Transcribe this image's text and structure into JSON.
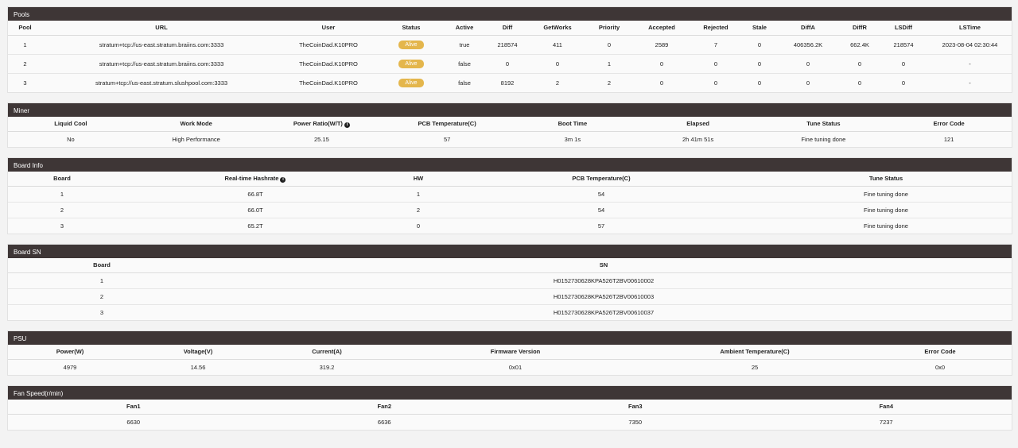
{
  "pools": {
    "title": "Pools",
    "columns": [
      "Pool",
      "URL",
      "User",
      "Status",
      "Active",
      "Diff",
      "GetWorks",
      "Priority",
      "Accepted",
      "Rejected",
      "Stale",
      "DiffA",
      "DiffR",
      "LSDiff",
      "LSTime"
    ],
    "rows": [
      [
        "1",
        "stratum+tcp://us-east.stratum.braiins.com:3333",
        "TheCoinDad.K10PRO",
        "Alive",
        "true",
        "218574",
        "411",
        "0",
        "2589",
        "7",
        "0",
        "406356.2K",
        "662.4K",
        "218574",
        "2023-08-04 02:30:44"
      ],
      [
        "2",
        "stratum+tcp://us-east.stratum.braiins.com:3333",
        "TheCoinDad.K10PRO",
        "Alive",
        "false",
        "0",
        "0",
        "1",
        "0",
        "0",
        "0",
        "0",
        "0",
        "0",
        "-"
      ],
      [
        "3",
        "stratum+tcp://us-east.stratum.slushpool.com:3333",
        "TheCoinDad.K10PRO",
        "Alive",
        "false",
        "8192",
        "2",
        "2",
        "0",
        "0",
        "0",
        "0",
        "0",
        "0",
        "-"
      ]
    ]
  },
  "miner": {
    "title": "Miner",
    "columns": [
      "Liquid Cool",
      "Work Mode",
      "Power Ratio(W/T)",
      "PCB Temperature(C)",
      "Boot Time",
      "Elapsed",
      "Tune Status",
      "Error Code"
    ],
    "rows": [
      [
        "No",
        "High Performance",
        "25.15",
        "57",
        "3m 1s",
        "2h 41m 51s",
        "Fine tuning done",
        "121"
      ]
    ]
  },
  "board_info": {
    "title": "Board Info",
    "columns": [
      "Board",
      "Real-time Hashrate",
      "HW",
      "PCB Temperature(C)",
      "Tune Status"
    ],
    "rows": [
      [
        "1",
        "66.8T",
        "1",
        "54",
        "Fine tuning done"
      ],
      [
        "2",
        "66.0T",
        "2",
        "54",
        "Fine tuning done"
      ],
      [
        "3",
        "65.2T",
        "0",
        "57",
        "Fine tuning done"
      ]
    ]
  },
  "board_sn": {
    "title": "Board SN",
    "columns": [
      "Board",
      "SN"
    ],
    "rows": [
      [
        "1",
        "H0152730628KPA526T2BV00610002"
      ],
      [
        "2",
        "H0152730628KPA526T2BV00610003"
      ],
      [
        "3",
        "H0152730628KPA526T2BV00610037"
      ]
    ]
  },
  "psu": {
    "title": "PSU",
    "columns": [
      "Power(W)",
      "Voltage(V)",
      "Current(A)",
      "Firmware Version",
      "Ambient Temperature(C)",
      "Error Code"
    ],
    "rows": [
      [
        "4979",
        "14.56",
        "319.2",
        "0x01",
        "25",
        "0x0"
      ]
    ]
  },
  "fan": {
    "title": "Fan Speed(r/min)",
    "columns": [
      "Fan1",
      "Fan2",
      "Fan3",
      "Fan4"
    ],
    "rows": [
      [
        "6630",
        "6636",
        "7350",
        "7237"
      ]
    ]
  },
  "icons": {
    "info": "info-circle-icon"
  },
  "colors": {
    "header_bg": "#3e3636",
    "badge": "#e4b64c"
  }
}
